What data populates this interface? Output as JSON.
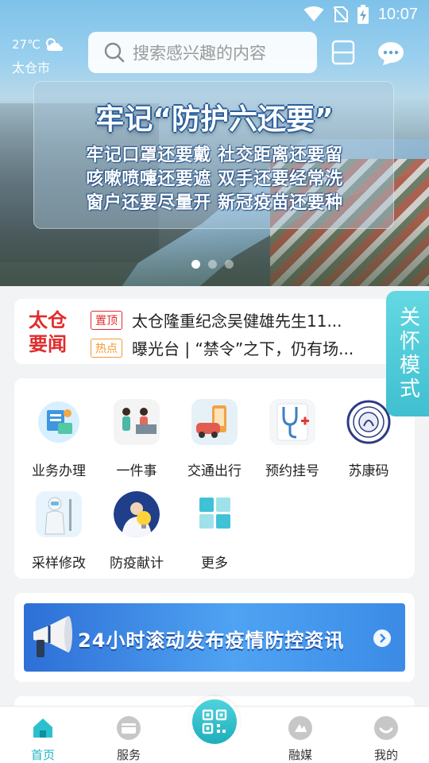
{
  "status_bar": {
    "time": "10:07"
  },
  "weather": {
    "temperature": "27℃",
    "city": "太仓市",
    "icon": "partly-cloudy-icon"
  },
  "search": {
    "placeholder": "搜索感兴趣的内容"
  },
  "banner": {
    "title": "牢记“防护六还要”",
    "lines": [
      "牢记口罩还要戴 社交距离还要留",
      "咳嗽喷嚏还要遮 双手还要经常洗",
      "窗户还要尽量开 新冠疫苗还要种"
    ],
    "page_count": 3,
    "active_page": 1
  },
  "news": {
    "brand": "太仓要闻",
    "items": [
      {
        "tag": "置顶",
        "text": "太仓隆重纪念吴健雄先生11..."
      },
      {
        "tag": "热点",
        "text": "曝光台 | “禁令”之下，仍有场..."
      }
    ]
  },
  "care_mode": {
    "label": "关怀模式"
  },
  "services": [
    {
      "label": "业务办理",
      "icon": "business-icon"
    },
    {
      "label": "一件事",
      "icon": "one-thing-icon"
    },
    {
      "label": "交通出行",
      "icon": "traffic-icon"
    },
    {
      "label": "预约挂号",
      "icon": "stethoscope-icon"
    },
    {
      "label": "苏康码",
      "icon": "sukang-code-icon"
    },
    {
      "label": "采样修改",
      "icon": "sampling-icon"
    },
    {
      "label": "防疫献计",
      "icon": "idea-bulb-icon"
    },
    {
      "label": "更多",
      "icon": "more-grid-icon"
    }
  ],
  "promo": {
    "text": "24小时滚动发布疫情防控资讯"
  },
  "bottom_nav": [
    {
      "label": "首页",
      "icon": "home-icon",
      "active": true
    },
    {
      "label": "服务",
      "icon": "wallet-icon",
      "active": false
    },
    {
      "label": "",
      "icon": "qr-scan-icon",
      "active": false
    },
    {
      "label": "融媒",
      "icon": "media-icon",
      "active": false
    },
    {
      "label": "我的",
      "icon": "profile-icon",
      "active": false
    }
  ],
  "colors": {
    "accent": "#1fb5c4",
    "news_red": "#e12b2b",
    "hot_orange": "#f29a2e",
    "care_tab": "#4fc9d8"
  }
}
